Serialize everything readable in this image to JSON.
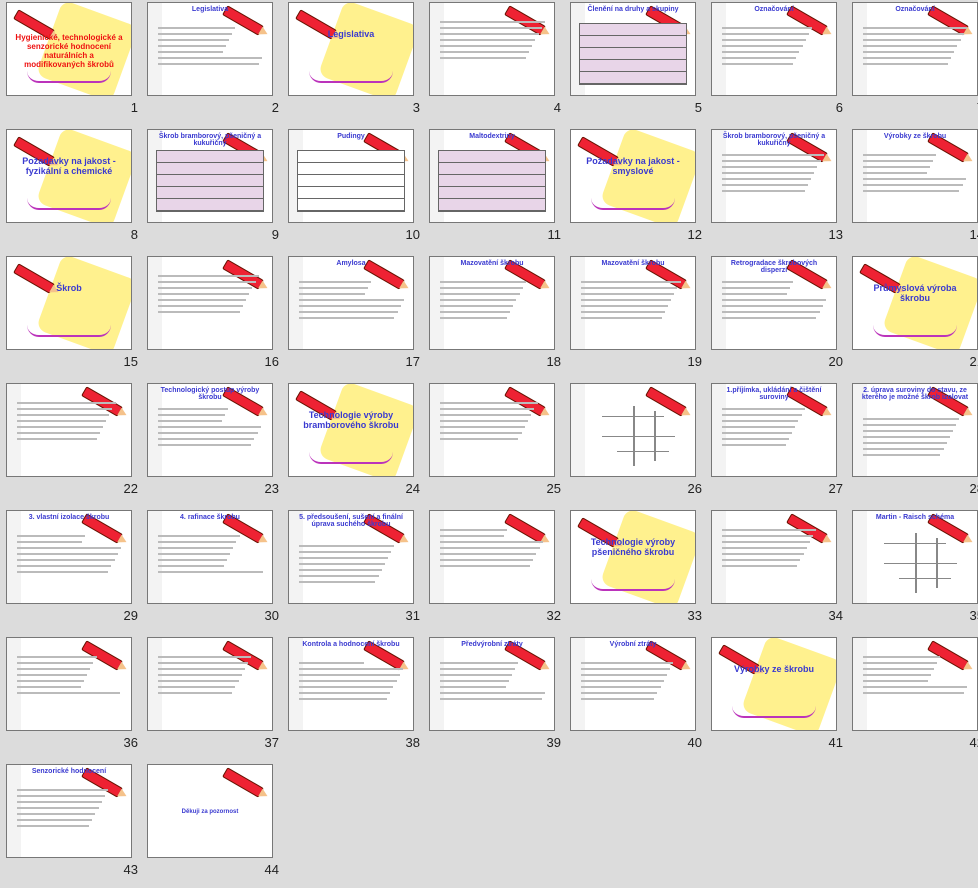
{
  "slides": [
    {
      "n": "1",
      "kind": "cover",
      "title": "Hygienické, technologické a senzorické hodnocení naturálních a modifikovaných škrobů"
    },
    {
      "n": "2",
      "kind": "text",
      "title": "Legislativa"
    },
    {
      "n": "3",
      "kind": "center",
      "title": "Legislativa"
    },
    {
      "n": "4",
      "kind": "text",
      "title": ""
    },
    {
      "n": "5",
      "kind": "table",
      "title": "Členění na druhy a skupiny"
    },
    {
      "n": "6",
      "kind": "text",
      "title": "Označování"
    },
    {
      "n": "7",
      "kind": "text",
      "title": "Označování"
    },
    {
      "n": "8",
      "kind": "center",
      "title": "Požadavky na jakost - fyzikální a chemické"
    },
    {
      "n": "9",
      "kind": "table",
      "title": "Škrob bramborový, pšeničný a kukuřičný"
    },
    {
      "n": "10",
      "kind": "table",
      "title": "Pudingy"
    },
    {
      "n": "11",
      "kind": "table",
      "title": "Maltodextriny"
    },
    {
      "n": "12",
      "kind": "center",
      "title": "Požadavky na jakost - smyslové"
    },
    {
      "n": "13",
      "kind": "text",
      "title": "Škrob bramborový, pšeničný a kukuřičný"
    },
    {
      "n": "14",
      "kind": "text",
      "title": "Výrobky ze škrobu"
    },
    {
      "n": "15",
      "kind": "center",
      "title": "Škrob"
    },
    {
      "n": "16",
      "kind": "text",
      "title": ""
    },
    {
      "n": "17",
      "kind": "text",
      "title": "Amylosa"
    },
    {
      "n": "18",
      "kind": "text",
      "title": "Mazovatění škrobu"
    },
    {
      "n": "19",
      "kind": "text",
      "title": "Mazovatění škrobu"
    },
    {
      "n": "20",
      "kind": "text",
      "title": "Retrogradace škrobových disperzí"
    },
    {
      "n": "21",
      "kind": "center",
      "title": "Průmyslová výroba škrobu"
    },
    {
      "n": "22",
      "kind": "text",
      "title": ""
    },
    {
      "n": "23",
      "kind": "text",
      "title": "Technologický postup výroby škrobu"
    },
    {
      "n": "24",
      "kind": "center",
      "title": "Technologie výroby bramborového škrobu"
    },
    {
      "n": "25",
      "kind": "text",
      "title": ""
    },
    {
      "n": "26",
      "kind": "flow",
      "title": ""
    },
    {
      "n": "27",
      "kind": "text",
      "title": "1.příjímka, ukládání a čištění suroviny"
    },
    {
      "n": "28",
      "kind": "text",
      "title": "2. úprava suroviny do stavu, ze kterého je možné škrob izolovat"
    },
    {
      "n": "29",
      "kind": "text",
      "title": "3. vlastní izolace škrobu"
    },
    {
      "n": "30",
      "kind": "text",
      "title": "4. rafinace škrobu"
    },
    {
      "n": "31",
      "kind": "text",
      "title": "5. předsoušení, sušení a finální úprava suchého škrobu"
    },
    {
      "n": "32",
      "kind": "text",
      "title": ""
    },
    {
      "n": "33",
      "kind": "center",
      "title": "Technologie výroby pšeničného škrobu"
    },
    {
      "n": "34",
      "kind": "text",
      "title": ""
    },
    {
      "n": "35",
      "kind": "flow",
      "title": "Martin - Raisch schéma"
    },
    {
      "n": "36",
      "kind": "text",
      "title": ""
    },
    {
      "n": "37",
      "kind": "text",
      "title": ""
    },
    {
      "n": "38",
      "kind": "text",
      "title": "Kontrola a hodnocení škrobu"
    },
    {
      "n": "39",
      "kind": "text",
      "title": "Předvýrobní ztráty"
    },
    {
      "n": "40",
      "kind": "text",
      "title": "Výrobní ztráty"
    },
    {
      "n": "41",
      "kind": "center",
      "title": "Výrobky ze škrobu"
    },
    {
      "n": "42",
      "kind": "text",
      "title": ""
    },
    {
      "n": "43",
      "kind": "text",
      "title": "Senzorické hodnocení"
    },
    {
      "n": "44",
      "kind": "end",
      "title": "Děkuji za pozornost"
    }
  ]
}
